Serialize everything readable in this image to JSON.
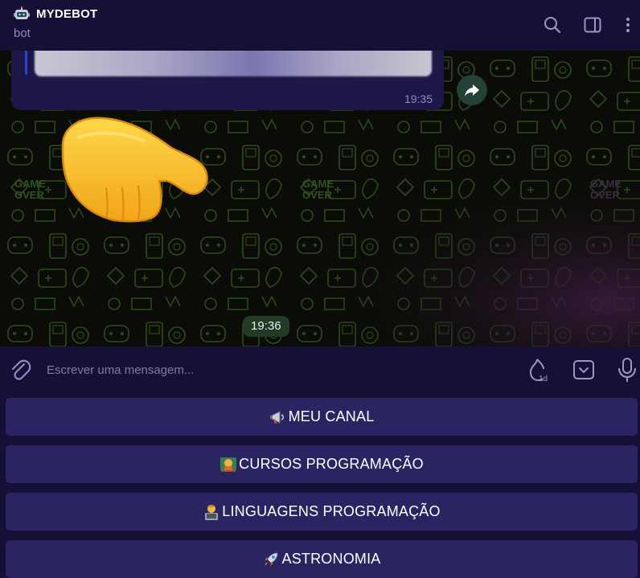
{
  "header": {
    "title": "MYDEBOT",
    "subtitle": "bot",
    "bot_icon": "robot-icon",
    "actions": [
      "search-icon",
      "sidebar-toggle-icon",
      "more-options-icon"
    ]
  },
  "chat": {
    "previous_message_time": "19:35",
    "sticker": "pointing-down-hand",
    "timestamp_pill": "19:36"
  },
  "composer": {
    "placeholder": "Escrever uma mensagem...",
    "timer_badge": "1d"
  },
  "keyboard": {
    "buttons": [
      {
        "icon": "megaphone-emoji",
        "label": "MEU CANAL"
      },
      {
        "icon": "teacher-emoji",
        "label": "CURSOS PROGRAMAÇÃO"
      },
      {
        "icon": "technologist-emoji",
        "label": "LINGUAGENS PROGRAMAÇÃO"
      },
      {
        "icon": "rocket-emoji",
        "label": "ASTRONOMIA"
      }
    ]
  },
  "colors": {
    "header_bg": "#161036",
    "button_bg": "#2b2463",
    "chat_bg": "#0b0c08",
    "pattern_green": "#2c4b1d",
    "pattern_purple": "#54295c",
    "pill_bg": "#233a25"
  }
}
